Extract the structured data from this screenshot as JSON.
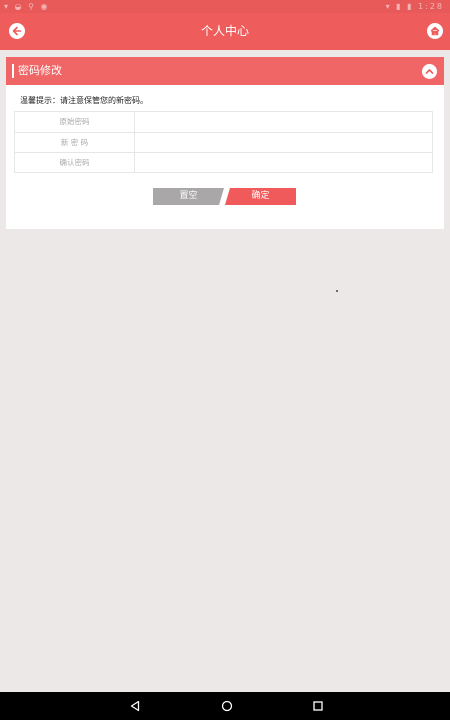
{
  "status_bar": {
    "left_icons": "▾ ◒ ⚲ ◉",
    "right_icons": "▾ ▮ ▮ 1:28"
  },
  "header": {
    "title": "个人中心",
    "back_icon": "back-arrow-icon",
    "home_icon": "home-icon"
  },
  "section": {
    "title": "密码修改",
    "collapse_icon": "chevron-up-icon"
  },
  "tip": "温馨提示：请注意保管您的新密码。",
  "form": {
    "rows": [
      {
        "label": "原始密码",
        "value": ""
      },
      {
        "label": "新 密 码",
        "value": ""
      },
      {
        "label": "确认密码",
        "value": ""
      }
    ]
  },
  "buttons": {
    "reset": "置空",
    "confirm": "确定"
  },
  "colors": {
    "accent": "#ef5c5c",
    "reset_gray": "#a9a7a8",
    "background": "#ece8e7"
  },
  "nav": {
    "back_icon": "triangle-back-icon",
    "home_icon": "circle-home-icon",
    "recent_icon": "square-recent-icon"
  }
}
